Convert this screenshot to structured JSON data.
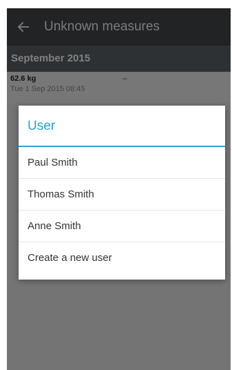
{
  "toolbar": {
    "back_icon": "arrow-left-icon",
    "title": "Unknown measures"
  },
  "section": {
    "header": "September 2015"
  },
  "measure": {
    "value": "62.6 kg",
    "date": "Tue 1 Sep 2015 08:45",
    "user": "–"
  },
  "dialog": {
    "title": "User",
    "items": [
      {
        "label": "Paul Smith"
      },
      {
        "label": "Thomas Smith"
      },
      {
        "label": "Anne Smith"
      },
      {
        "label": "Create a new user"
      }
    ]
  },
  "colors": {
    "accent": "#29a3cc",
    "toolbar": "#43474a",
    "section_header": "#5c6366"
  }
}
